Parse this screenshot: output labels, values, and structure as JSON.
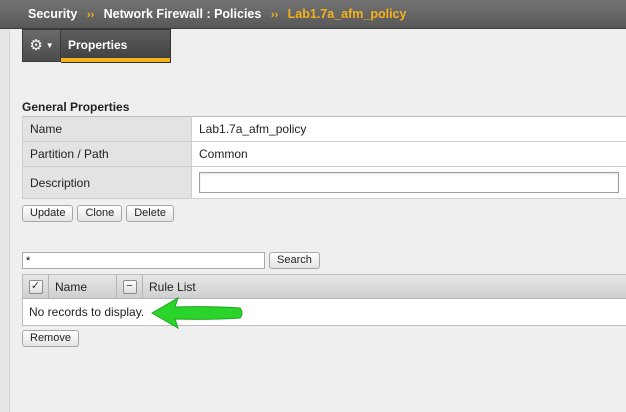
{
  "breadcrumb": {
    "items": [
      "Security",
      "Network Firewall : Policies"
    ],
    "separator": "››",
    "current": "Lab1.7a_afm_policy"
  },
  "tabs": {
    "gear_icon": "gear-icon",
    "properties_label": "Properties"
  },
  "general_properties": {
    "title": "General Properties",
    "rows": [
      {
        "label": "Name",
        "value": "Lab1.7a_afm_policy"
      },
      {
        "label": "Partition / Path",
        "value": "Common"
      },
      {
        "label": "Description",
        "value": ""
      }
    ]
  },
  "actions": {
    "update_label": "Update",
    "clone_label": "Clone",
    "delete_label": "Delete"
  },
  "search": {
    "value": "*",
    "button_label": "Search"
  },
  "rules_table": {
    "columns": [
      "Name",
      "Rule List"
    ],
    "empty_message": "No records to display."
  },
  "remove_label": "Remove",
  "colors": {
    "accent": "#f5b21c",
    "annotation_arrow": "#2bd42b"
  }
}
